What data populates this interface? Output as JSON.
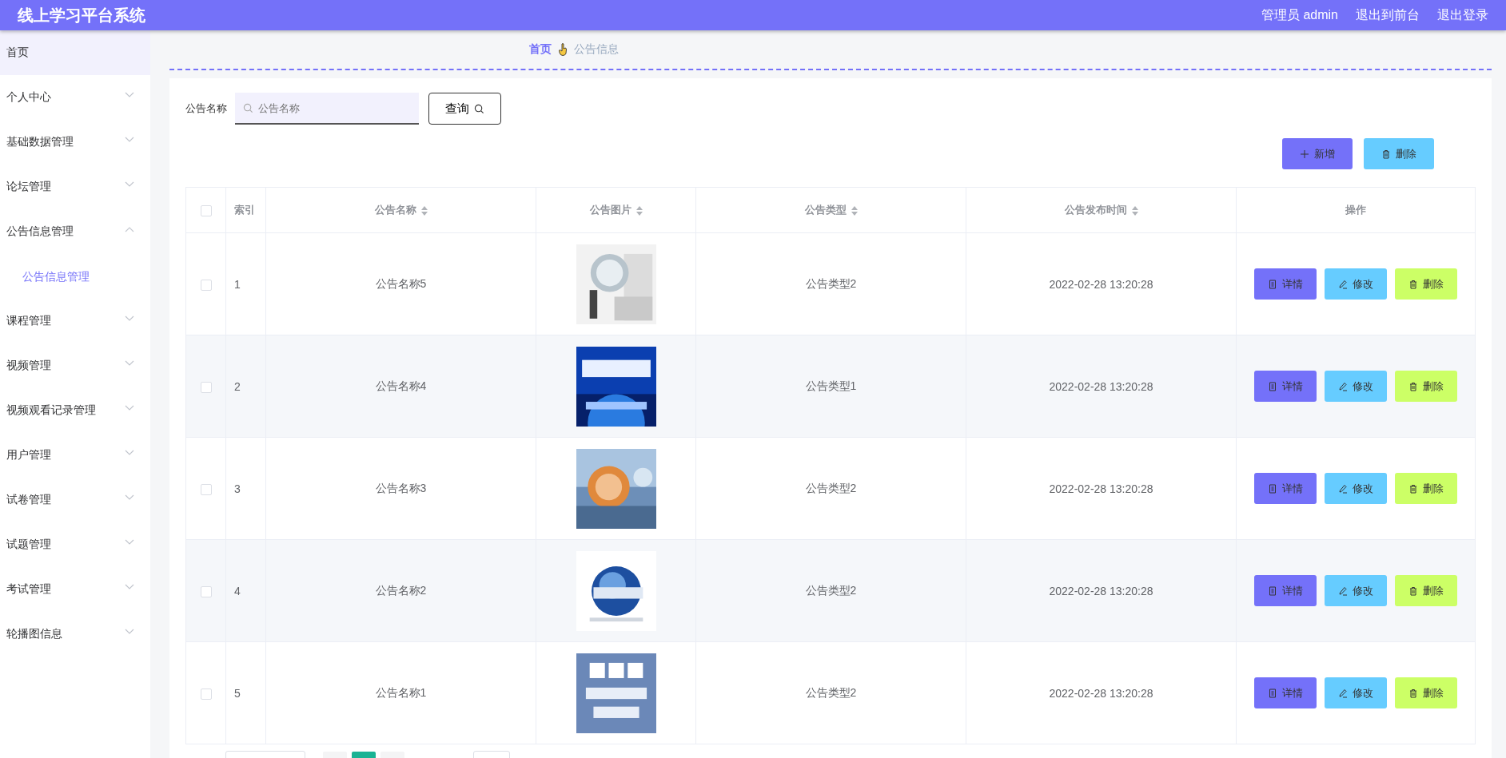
{
  "header": {
    "title": "线上学习平台系统",
    "links": [
      "管理员 admin",
      "退出到前台",
      "退出登录"
    ]
  },
  "sidebar": {
    "items": [
      {
        "label": "首页",
        "selected": true
      },
      {
        "label": "个人中心",
        "selected": false,
        "expanded": false
      },
      {
        "label": "基础数据管理",
        "selected": false,
        "expanded": false
      },
      {
        "label": "论坛管理",
        "selected": false,
        "expanded": false
      },
      {
        "label": "公告信息管理",
        "selected": false,
        "expanded": true,
        "children": [
          {
            "label": "公告信息管理",
            "selected": true
          }
        ]
      },
      {
        "label": "课程管理",
        "selected": false,
        "expanded": false
      },
      {
        "label": "视频管理",
        "selected": false,
        "expanded": false
      },
      {
        "label": "视频观看记录管理",
        "selected": false,
        "expanded": false
      },
      {
        "label": "用户管理",
        "selected": false,
        "expanded": false
      },
      {
        "label": "试卷管理",
        "selected": false,
        "expanded": false
      },
      {
        "label": "试题管理",
        "selected": false,
        "expanded": false
      },
      {
        "label": "考试管理",
        "selected": false,
        "expanded": false
      },
      {
        "label": "轮播图信息",
        "selected": false,
        "expanded": false
      }
    ]
  },
  "breadcrumb": [
    "首页",
    "公告信息"
  ],
  "search": {
    "label": "公告名称",
    "placeholder": "公告名称",
    "button": "查询"
  },
  "actions": [
    {
      "kind": "add",
      "label": "新增"
    },
    {
      "kind": "delete",
      "label": "删除"
    }
  ],
  "table": {
    "select_all_checked": false,
    "columns": [
      {
        "label": "索引",
        "sortable": false
      },
      {
        "label": "公告名称",
        "sortable": true
      },
      {
        "label": "公告图片",
        "sortable": true
      },
      {
        "label": "公告类型",
        "sortable": true
      },
      {
        "label": "公告发布时间",
        "sortable": true
      },
      {
        "label": "操作",
        "sortable": false
      }
    ],
    "rows": [
      {
        "checked": false,
        "index": "1",
        "name": "公告名称5",
        "type": "公告类型2",
        "time": "2022-02-28 13:20:28",
        "actions": [
          {
            "kind": "detail",
            "label": "详情"
          },
          {
            "kind": "edit",
            "label": "修改"
          },
          {
            "kind": "delete",
            "label": "删除"
          }
        ]
      },
      {
        "checked": false,
        "index": "2",
        "name": "公告名称4",
        "type": "公告类型1",
        "time": "2022-02-28 13:20:28",
        "actions": [
          {
            "kind": "detail",
            "label": "详情"
          },
          {
            "kind": "edit",
            "label": "修改"
          },
          {
            "kind": "delete",
            "label": "删除"
          }
        ]
      },
      {
        "checked": false,
        "index": "3",
        "name": "公告名称3",
        "type": "公告类型2",
        "time": "2022-02-28 13:20:28",
        "actions": [
          {
            "kind": "detail",
            "label": "详情"
          },
          {
            "kind": "edit",
            "label": "修改"
          },
          {
            "kind": "delete",
            "label": "删除"
          }
        ]
      },
      {
        "checked": false,
        "index": "4",
        "name": "公告名称2",
        "type": "公告类型2",
        "time": "2022-02-28 13:20:28",
        "actions": [
          {
            "kind": "detail",
            "label": "详情"
          },
          {
            "kind": "edit",
            "label": "修改"
          },
          {
            "kind": "delete",
            "label": "删除"
          }
        ]
      },
      {
        "checked": false,
        "index": "5",
        "name": "公告名称1",
        "type": "公告类型2",
        "time": "2022-02-28 13:20:28",
        "actions": [
          {
            "kind": "detail",
            "label": "详情"
          },
          {
            "kind": "edit",
            "label": "修改"
          },
          {
            "kind": "delete",
            "label": "删除"
          }
        ]
      }
    ]
  },
  "pagination": {
    "pages": [
      {
        "selected": false
      },
      {
        "selected": true
      },
      {
        "selected": false
      }
    ]
  }
}
